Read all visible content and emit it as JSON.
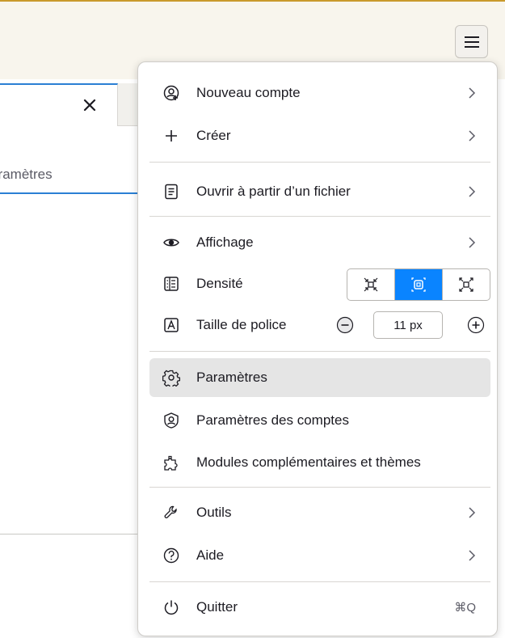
{
  "toolbar": {
    "menu_icon": "hamburger-icon"
  },
  "tab": {
    "close_icon": "close-icon"
  },
  "search": {
    "placeholder": "Rechercher dans les paramètres"
  },
  "menu": {
    "items": {
      "new_account": {
        "label": "Nouveau compte",
        "icon": "new-account-icon",
        "has_submenu": true
      },
      "create": {
        "label": "Créer",
        "icon": "plus-icon",
        "has_submenu": true
      },
      "open_file": {
        "label": "Ouvrir à partir d’un fichier",
        "icon": "file-icon",
        "has_submenu": true
      },
      "view": {
        "label": "Affichage",
        "icon": "eye-icon",
        "has_submenu": true
      },
      "density": {
        "label": "Densité",
        "icon": "density-icon",
        "options": [
          "compact",
          "normal",
          "relaxed"
        ],
        "selected": "normal"
      },
      "font_size": {
        "label": "Taille de police",
        "icon": "font-size-icon",
        "value": "11 px"
      },
      "settings": {
        "label": "Paramètres",
        "icon": "gear-icon",
        "highlighted": true
      },
      "account_settings": {
        "label": "Paramètres des comptes",
        "icon": "account-settings-icon"
      },
      "addons": {
        "label": "Modules complémentaires et thèmes",
        "icon": "puzzle-icon"
      },
      "tools": {
        "label": "Outils",
        "icon": "wrench-icon",
        "has_submenu": true
      },
      "help": {
        "label": "Aide",
        "icon": "help-icon",
        "has_submenu": true
      },
      "quit": {
        "label": "Quitter",
        "icon": "power-icon",
        "shortcut": "⌘Q"
      }
    }
  },
  "colors": {
    "accent": "#0a84ff",
    "highlight": "#e5e5e5",
    "toolbar_border": "#c99a2c",
    "tab_accent": "#2a7fd4"
  }
}
